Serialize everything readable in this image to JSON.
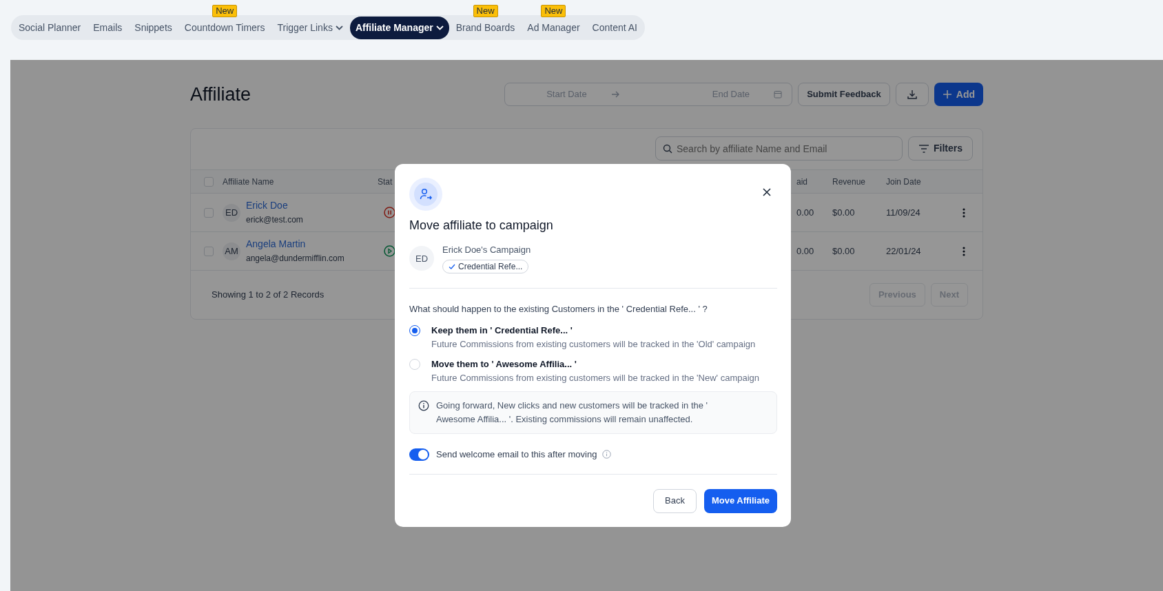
{
  "nav": [
    {
      "label": "Social Planner",
      "selected": false,
      "dropdown": false
    },
    {
      "label": "Emails",
      "selected": false,
      "dropdown": false
    },
    {
      "label": "Snippets",
      "selected": false,
      "dropdown": false
    },
    {
      "label": "Countdown Timers",
      "selected": false,
      "dropdown": false,
      "badge": "New"
    },
    {
      "label": "Trigger Links",
      "selected": false,
      "dropdown": true
    },
    {
      "label": "Affiliate Manager",
      "selected": true,
      "dropdown": true
    },
    {
      "label": "Brand Boards",
      "selected": false,
      "dropdown": false,
      "badge": "New"
    },
    {
      "label": "Ad Manager",
      "selected": false,
      "dropdown": false,
      "badge": "New"
    },
    {
      "label": "Content AI",
      "selected": false,
      "dropdown": false
    }
  ],
  "page": {
    "title": "Affiliate",
    "date_range": {
      "start_placeholder": "Start Date",
      "end_placeholder": "End Date"
    },
    "feedback_button": "Submit Feedback",
    "add_button": "Add"
  },
  "table": {
    "search_placeholder": "Search by affiliate Name and Email",
    "filters_button": "Filters",
    "select_all_checked": false,
    "columns": [
      "Affiliate Name",
      "Stat",
      "aid",
      "Revenue",
      "Join Date"
    ],
    "rows": [
      {
        "checked": false,
        "initials": "ED",
        "name": "Erick Doe",
        "email": "erick@test.com",
        "kind": "paused",
        "paid": "0.00",
        "revenue": "$0.00",
        "join_date": "11/09/24"
      },
      {
        "checked": false,
        "initials": "AM",
        "name": "Angela Martin",
        "email": "angela@dundermifflin.com",
        "kind": "active",
        "paid": "0.00",
        "revenue": "$0.00",
        "join_date": "22/01/24"
      }
    ],
    "footer": "Showing 1 to 2 of 2 Records",
    "pagination": [
      {
        "label": "Previous",
        "disabled": true
      },
      {
        "label": "Next",
        "disabled": true
      }
    ]
  },
  "modal": {
    "title": "Move affiliate to campaign",
    "campaign": {
      "initials": "ED",
      "name": "Erick Doe's Campaign",
      "tag": "Credential Refe..."
    },
    "question": "What should happen to the existing Customers in the ' Credential Refe... ' ?",
    "options": [
      {
        "label": "Keep them in ' Credential Refe... '",
        "description": "Future Commissions from existing customers will be tracked in the 'Old' campaign",
        "selected": true
      },
      {
        "label": "Move them to ' Awesome Affilia... '",
        "description": "Future Commissions from existing customers will be tracked in the 'New' campaign",
        "selected": false
      }
    ],
    "info": "Going forward, New clicks and new customers will be tracked in the ' Awesome Affilia... '. Existing commissions will remain unaffected.",
    "toggle": {
      "label": "Send welcome email to this after moving",
      "on": true
    },
    "back_button": "Back",
    "confirm_button": "Move Affiliate"
  }
}
